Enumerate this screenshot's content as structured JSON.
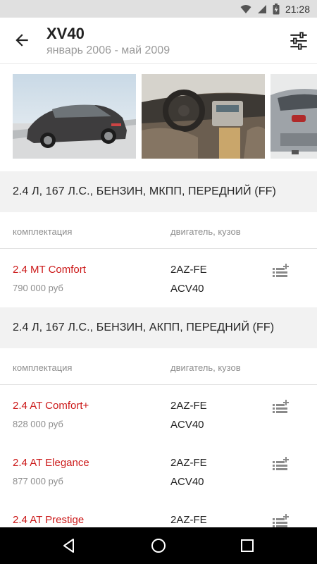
{
  "status_bar": {
    "time": "21:28",
    "icons": [
      "wifi-icon",
      "cellular-icon",
      "battery-charging-icon"
    ]
  },
  "header": {
    "title": "XV40",
    "subtitle": "январь 2006 - май 2009",
    "back_icon": "arrow-back-icon",
    "filter_icon": "sliders-icon"
  },
  "gallery": {
    "images": [
      "car-exterior-photo",
      "car-interior-photo",
      "car-rear-photo"
    ]
  },
  "sections": [
    {
      "title": "2.4 Л, 167 Л.С., БЕНЗИН, МКПП, ПЕРЕДНИЙ (FF)",
      "columns": {
        "trim": "комплектация",
        "engine_body": "двигатель, кузов"
      },
      "rows": [
        {
          "name": "2.4 MT Comfort",
          "price": "790 000 руб",
          "engine": "2AZ-FE",
          "body": "ACV40"
        }
      ]
    },
    {
      "title": "2.4 Л, 167 Л.С., БЕНЗИН, АКПП, ПЕРЕДНИЙ (FF)",
      "columns": {
        "trim": "комплектация",
        "engine_body": "двигатель, кузов"
      },
      "rows": [
        {
          "name": "2.4 AT Comfort+",
          "price": "828 000 руб",
          "engine": "2AZ-FE",
          "body": "ACV40"
        },
        {
          "name": "2.4 AT Elegance",
          "price": "877 000 руб",
          "engine": "2AZ-FE",
          "body": "ACV40"
        },
        {
          "name": "2.4 AT Prestige",
          "price": "",
          "engine": "2AZ-FE",
          "body": ""
        }
      ]
    }
  ],
  "colors": {
    "accent": "#cc1a1a",
    "section_bg": "#f2f2f2",
    "status_bar": "#e0e0e0",
    "nav_bar": "#000000"
  },
  "nav_bar": {
    "icons": [
      "back-triangle-icon",
      "home-circle-icon",
      "recents-square-icon"
    ]
  }
}
